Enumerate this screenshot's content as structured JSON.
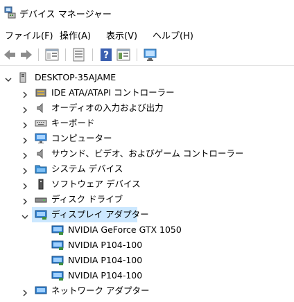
{
  "window": {
    "title": "デバイス マネージャー"
  },
  "menu": [
    "ファイル(F)",
    "操作(A)",
    "表示(V)",
    "ヘルプ(H)"
  ],
  "toolbar": [
    "back-icon",
    "forward-icon",
    "properties-icon",
    "update-icon",
    "help-icon",
    "view-icon",
    "scan-icon"
  ],
  "tree": {
    "root": "DESKTOP-35AJAME",
    "items": [
      {
        "label": "IDE ATA/ATAPI コントローラー",
        "icon": "ide-controller-icon",
        "expanded": false
      },
      {
        "label": "オーディオの入力および出力",
        "icon": "speaker-icon",
        "expanded": false
      },
      {
        "label": "キーボード",
        "icon": "keyboard-icon",
        "expanded": false
      },
      {
        "label": "コンピューター",
        "icon": "computer-icon",
        "expanded": false
      },
      {
        "label": "サウンド、ビデオ、およびゲーム コントローラー",
        "icon": "speaker-icon",
        "expanded": false
      },
      {
        "label": "システム デバイス",
        "icon": "system-folder-icon",
        "expanded": false
      },
      {
        "label": "ソフトウェア デバイス",
        "icon": "software-device-icon",
        "expanded": false
      },
      {
        "label": "ディスク ドライブ",
        "icon": "disk-drive-icon",
        "expanded": false
      },
      {
        "label": "ディスプレイ アダプター",
        "icon": "display-adapter-icon",
        "expanded": true,
        "selected": true,
        "children": [
          "NVIDIA GeForce GTX 1050",
          "NVIDIA P104-100",
          "NVIDIA P104-100",
          "NVIDIA P104-100"
        ]
      },
      {
        "label": "ネットワーク アダプター",
        "icon": "network-adapter-icon",
        "expanded": false
      }
    ]
  },
  "colors": {
    "selection": "#cce8ff",
    "accent": "#1e78d4"
  }
}
